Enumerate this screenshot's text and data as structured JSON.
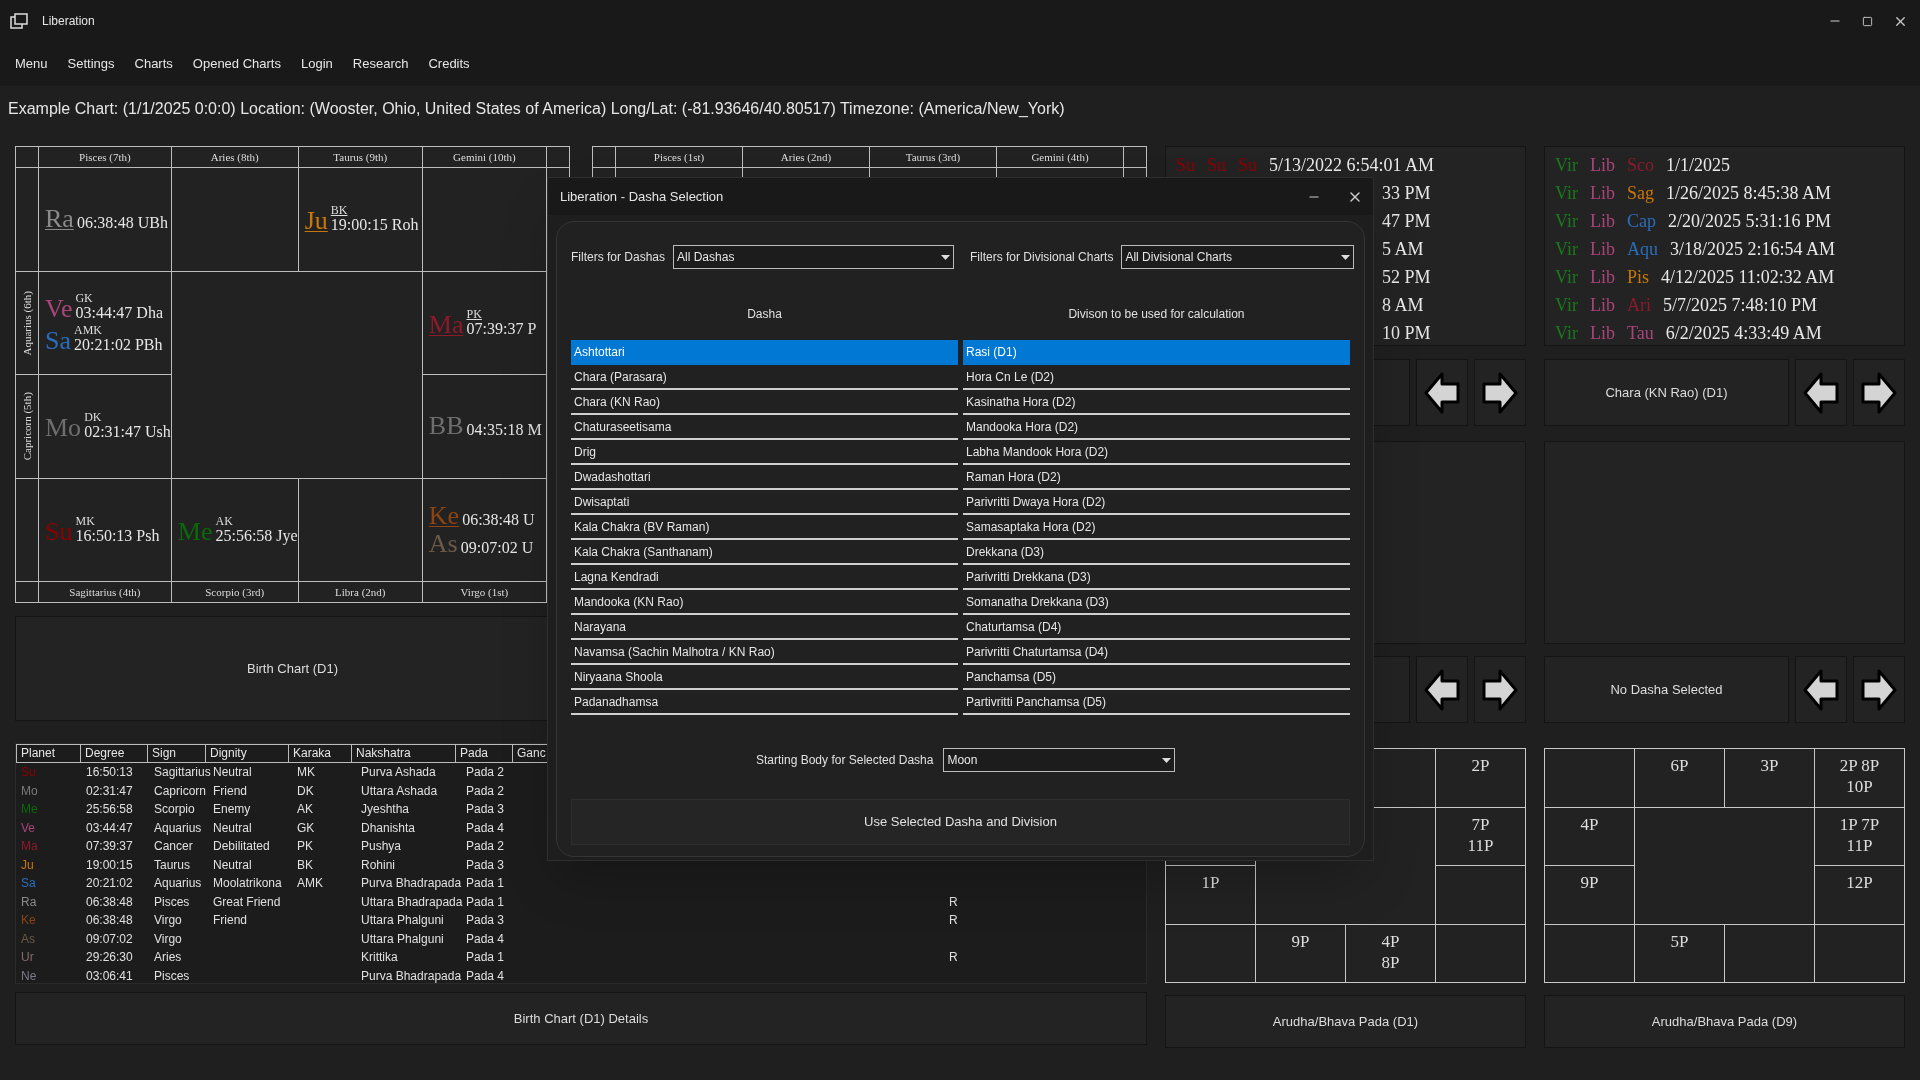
{
  "window": {
    "title": "Liberation"
  },
  "menu": [
    "Menu",
    "Settings",
    "Charts",
    "Opened Charts",
    "Login",
    "Research",
    "Credits"
  ],
  "info_line": "Example Chart: (1/1/2025 0:0:0) Location: (Wooster, Ohio, United States of America) Long/Lat: (-81.93646/40.80517) Timezone: (America/New_York)",
  "birth_chart": {
    "top_labels": [
      "Pisces (7th)",
      "Aries (8th)",
      "Taurus (9th)",
      "Gemini (10th)"
    ],
    "bottom_labels": [
      "Sagittarius (4th)",
      "Scorpio (3rd)",
      "Libra (2nd)",
      "Virgo (1st)"
    ],
    "left_labels": [
      "Aquarius (6th)",
      "Capricorn (5th)"
    ],
    "houses": {
      "pisces": {
        "planets": [
          {
            "abbr": "Ra",
            "color": "#8a8a8a",
            "underlined": true,
            "position": "06:38:48 UBh"
          }
        ]
      },
      "taurus": {
        "planets": [
          {
            "abbr": "Ju",
            "color": "#c8780a",
            "underlined": true,
            "karaka": "BK",
            "position": "19:00:15 Roh"
          }
        ]
      },
      "aquarius": {
        "planets": [
          {
            "abbr": "Ve",
            "color": "#a8457a",
            "underlined": false,
            "karaka": "GK",
            "position": "03:44:47 Dha"
          },
          {
            "abbr": "Sa",
            "color": "#2a6ebb",
            "underlined": false,
            "karaka": "AMK",
            "position": "20:21:02 PBh"
          }
        ]
      },
      "cancer": {
        "planets": [
          {
            "abbr": "Ma",
            "color": "#8b1a2b",
            "underlined": true,
            "karaka": "PK",
            "position": "07:39:37 P"
          }
        ]
      },
      "capricorn": {
        "planets": [
          {
            "abbr": "Mo",
            "color": "#6e6e6e",
            "underlined": false,
            "karaka": "DK",
            "position": "02:31:47 Ush"
          }
        ]
      },
      "leo": {
        "planets": [
          {
            "abbr": "BB",
            "color": "#6e6e6e",
            "underlined": false,
            "position": "04:35:18 M"
          }
        ]
      },
      "sagittarius": {
        "planets": [
          {
            "abbr": "Su",
            "color": "#8b0000",
            "underlined": false,
            "karaka": "MK",
            "position": "16:50:13 Psh"
          }
        ]
      },
      "scorpio": {
        "planets": [
          {
            "abbr": "Me",
            "color": "#0a6a0a",
            "underlined": false,
            "karaka": "AK",
            "position": "25:56:58 Jye"
          }
        ]
      },
      "virgo": {
        "planets": [
          {
            "abbr": "Ke",
            "color": "#8b4513",
            "underlined": true,
            "position": "06:38:48 U"
          },
          {
            "abbr": "As",
            "color": "#6b5a45",
            "underlined": false,
            "position": "09:07:02 U"
          }
        ]
      }
    }
  },
  "second_chart": {
    "top_labels": [
      "Pisces (1st)",
      "Aries (2nd)",
      "Taurus (3rd)",
      "Gemini (4th)"
    ]
  },
  "birth_chart_button": "Birth Chart (D1)",
  "planet_table": {
    "columns": [
      "Planet",
      "Degree",
      "Sign",
      "Dignity",
      "Karaka",
      "Nakshatra",
      "Pada",
      "Ganc"
    ],
    "rows": [
      {
        "color": "#8b0000",
        "planet": "Su",
        "degree": "16:50:13",
        "sign": "Sagittarius",
        "dignity": "Neutral",
        "karaka": "MK",
        "nakshatra": "Purva Ashada",
        "pada": "Pada 2"
      },
      {
        "color": "#7a7a7a",
        "planet": "Mo",
        "degree": "02:31:47",
        "sign": "Capricorn",
        "dignity": "Friend",
        "karaka": "DK",
        "nakshatra": "Uttara Ashada",
        "pada": "Pada 2"
      },
      {
        "color": "#0a6a0a",
        "planet": "Me",
        "degree": "25:56:58",
        "sign": "Scorpio",
        "dignity": "Enemy",
        "karaka": "AK",
        "nakshatra": "Jyeshtha",
        "pada": "Pada 3"
      },
      {
        "color": "#a8457a",
        "planet": "Ve",
        "degree": "03:44:47",
        "sign": "Aquarius",
        "dignity": "Neutral",
        "karaka": "GK",
        "nakshatra": "Dhanishta",
        "pada": "Pada 4"
      },
      {
        "color": "#8b1a2b",
        "planet": "Ma",
        "degree": "07:39:37",
        "sign": "Cancer",
        "dignity": "Debilitated",
        "karaka": "PK",
        "nakshatra": "Pushya",
        "pada": "Pada 2"
      },
      {
        "color": "#c8780a",
        "planet": "Ju",
        "degree": "19:00:15",
        "sign": "Taurus",
        "dignity": "Neutral",
        "karaka": "BK",
        "nakshatra": "Rohini",
        "pada": "Pada 3"
      },
      {
        "color": "#2a6ebb",
        "planet": "Sa",
        "degree": "20:21:02",
        "sign": "Aquarius",
        "dignity": "Moolatrikona",
        "karaka": "AMK",
        "nakshatra": "Purva Bhadrapada",
        "pada": "Pada 1"
      },
      {
        "color": "#8a8a8a",
        "planet": "Ra",
        "degree": "06:38:48",
        "sign": "Pisces",
        "dignity": "Great Friend",
        "nakshatra": "Uttara Bhadrapada",
        "pada": "Pada 1",
        "column_9": "R"
      },
      {
        "color": "#8b4513",
        "planet": "Ke",
        "degree": "06:38:48",
        "sign": "Virgo",
        "dignity": "Friend",
        "nakshatra": "Uttara Phalguni",
        "pada": "Pada 3",
        "column_9": "R"
      },
      {
        "color": "#6b5a45",
        "planet": "As",
        "degree": "09:07:02",
        "sign": "Virgo",
        "nakshatra": "Uttara Phalguni",
        "pada": "Pada 4"
      },
      {
        "color": "#8a6a6a",
        "planet": "Ur",
        "degree": "29:26:30",
        "sign": "Aries",
        "nakshatra": "Krittika",
        "pada": "Pada 1",
        "column_9": "R"
      },
      {
        "color": "#7a7a8a",
        "planet": "Ne",
        "degree": "03:06:41",
        "sign": "Pisces",
        "nakshatra": "Purva Bhadrapada",
        "pada": "Pada 4"
      }
    ]
  },
  "details_button": "Birth Chart (D1) Details",
  "right_columns": [
    {
      "timeline": [
        {
          "signs": [
            {
              "name": "Su",
              "color": "#8b0000"
            },
            {
              "name": "Su",
              "color": "#8b0000"
            },
            {
              "name": "Su",
              "color": "#8b0000"
            }
          ],
          "date": "5/13/2022 6:54:01 AM"
        },
        {
          "date": "33 PM"
        },
        {
          "date": "47 PM"
        },
        {
          "date": "5 AM"
        },
        {
          "date": "52 PM"
        },
        {
          "date": "8 AM"
        },
        {
          "date": "10 PM"
        }
      ],
      "pada_chart": {
        "cells": {
          "gemini": [
            "2P"
          ],
          "cancer": [
            "7P",
            "11P"
          ],
          "capricorn": [
            "1P"
          ],
          "scorpio": [
            "9P"
          ],
          "libra": [
            "4P",
            "8P"
          ]
        }
      },
      "pada_label": "Arudha/Bhava Pada (D1)"
    },
    {
      "timeline": [
        {
          "signs": [
            {
              "name": "Vir",
              "color": "#1a7a1a"
            },
            {
              "name": "Lib",
              "color": "#a8457a"
            },
            {
              "name": "Sco",
              "color": "#8b1a2b"
            }
          ],
          "date": "1/1/2025"
        },
        {
          "signs": [
            {
              "name": "Vir",
              "color": "#1a7a1a"
            },
            {
              "name": "Lib",
              "color": "#a8457a"
            },
            {
              "name": "Sag",
              "color": "#c8780a"
            }
          ],
          "date": "1/26/2025 8:45:38 AM"
        },
        {
          "signs": [
            {
              "name": "Vir",
              "color": "#1a7a1a"
            },
            {
              "name": "Lib",
              "color": "#a8457a"
            },
            {
              "name": "Cap",
              "color": "#2a6ebb"
            }
          ],
          "date": "2/20/2025 5:31:16 PM"
        },
        {
          "signs": [
            {
              "name": "Vir",
              "color": "#1a7a1a"
            },
            {
              "name": "Lib",
              "color": "#a8457a"
            },
            {
              "name": "Aqu",
              "color": "#2a6ebb"
            }
          ],
          "date": "3/18/2025 2:16:54 AM"
        },
        {
          "signs": [
            {
              "name": "Vir",
              "color": "#1a7a1a"
            },
            {
              "name": "Lib",
              "color": "#a8457a"
            },
            {
              "name": "Pis",
              "color": "#c8780a"
            }
          ],
          "date": "4/12/2025 11:02:32 AM"
        },
        {
          "signs": [
            {
              "name": "Vir",
              "color": "#1a7a1a"
            },
            {
              "name": "Lib",
              "color": "#a8457a"
            },
            {
              "name": "Ari",
              "color": "#8b1a2b"
            }
          ],
          "date": "5/7/2025 7:48:10 PM"
        },
        {
          "signs": [
            {
              "name": "Vir",
              "color": "#1a7a1a"
            },
            {
              "name": "Lib",
              "color": "#a8457a"
            },
            {
              "name": "Tau",
              "color": "#a8457a"
            }
          ],
          "date": "6/2/2025 4:33:49 AM"
        }
      ],
      "navigator_labels": [
        "Chara (KN Rao) (D1)",
        "No Dasha Selected"
      ],
      "pada_chart": {
        "cells": {
          "aries": [
            "6P"
          ],
          "taurus": [
            "3P"
          ],
          "gemini": [
            "2P 8P",
            "10P"
          ],
          "aquarius": [
            "4P"
          ],
          "cancer": [
            "1P 7P",
            "11P"
          ],
          "capricorn": [
            "9P"
          ],
          "leo": [
            "12P"
          ],
          "scorpio": [
            "5P"
          ]
        }
      },
      "pada_label": "Arudha/Bhava Pada (D9)"
    }
  ],
  "dialog": {
    "title": "Liberation - Dasha Selection",
    "dasha_filter": {
      "label": "Filters for Dashas",
      "value": "All Dashas"
    },
    "division_filter": {
      "label": "Filters for Divisional Charts",
      "value": "All Divisional Charts"
    },
    "dasha_header": "Dasha",
    "division_header": "Divison to be used for calculation",
    "dashas": [
      {
        "label": "Ashtottari",
        "selected": true
      },
      {
        "label": "Chara (Parasara)",
        "selected": false
      },
      {
        "label": "Chara (KN Rao)",
        "selected": false
      },
      {
        "label": "Chaturaseetisama",
        "selected": false
      },
      {
        "label": "Drig",
        "selected": false
      },
      {
        "label": "Dwadashottari",
        "selected": false
      },
      {
        "label": "Dwisaptati",
        "selected": false
      },
      {
        "label": "Kala Chakra (BV Raman)",
        "selected": false
      },
      {
        "label": "Kala Chakra (Santhanam)",
        "selected": false
      },
      {
        "label": "Lagna Kendradi",
        "selected": false
      },
      {
        "label": "Mandooka (KN Rao)",
        "selected": false
      },
      {
        "label": "Narayana",
        "selected": false
      },
      {
        "label": "Navamsa (Sachin Malhotra / KN Rao)",
        "selected": false
      },
      {
        "label": "Niryaana Shoola",
        "selected": false
      },
      {
        "label": "Padanadhamsa",
        "selected": false
      }
    ],
    "divisions": [
      {
        "label": "Rasi (D1)",
        "selected": true
      },
      {
        "label": "Hora Cn Le (D2)",
        "selected": false
      },
      {
        "label": "Kasinatha Hora (D2)",
        "selected": false
      },
      {
        "label": "Mandooka Hora (D2)",
        "selected": false
      },
      {
        "label": "Labha Mandook Hora (D2)",
        "selected": false
      },
      {
        "label": "Raman Hora (D2)",
        "selected": false
      },
      {
        "label": "Parivritti Dwaya Hora (D2)",
        "selected": false
      },
      {
        "label": "Samasaptaka Hora (D2)",
        "selected": false
      },
      {
        "label": "Drekkana (D3)",
        "selected": false
      },
      {
        "label": "Parivritti Drekkana (D3)",
        "selected": false
      },
      {
        "label": "Somanatha Drekkana (D3)",
        "selected": false
      },
      {
        "label": "Chaturtamsa (D4)",
        "selected": false
      },
      {
        "label": "Parivritti Chaturtamsa (D4)",
        "selected": false
      },
      {
        "label": "Panchamsa (D5)",
        "selected": false
      },
      {
        "label": "Partivritti Panchamsa (D5)",
        "selected": false
      }
    ],
    "starting_body": {
      "label": "Starting Body for Selected Dasha",
      "value": "Moon"
    },
    "confirm_button": "Use Selected Dasha and Division"
  }
}
